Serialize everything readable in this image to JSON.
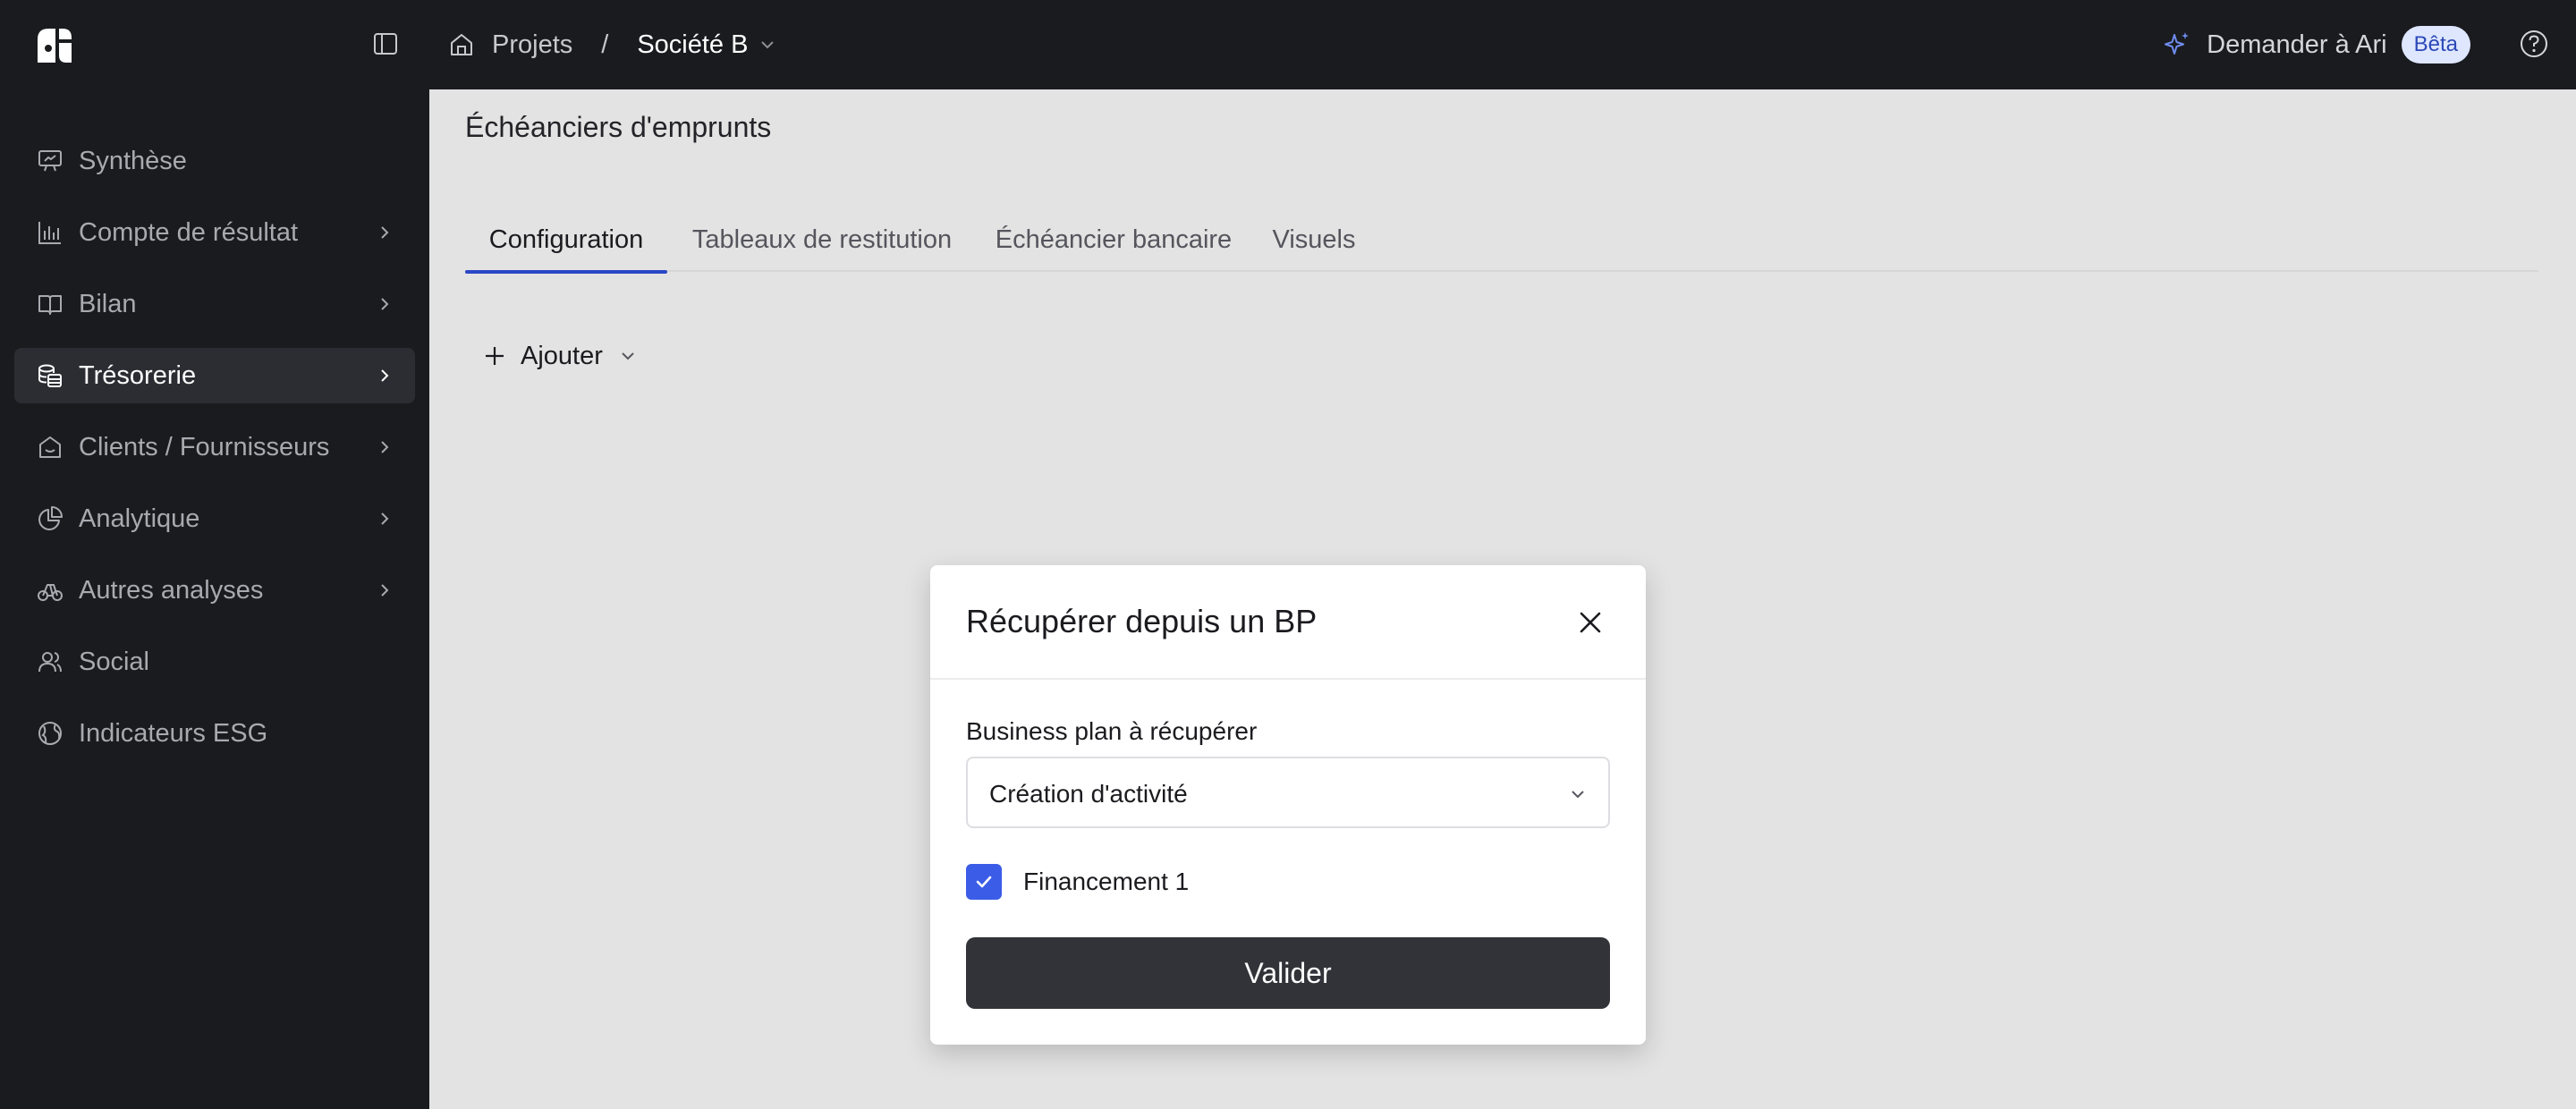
{
  "topbar": {
    "breadcrumb": {
      "root": "Projets",
      "separator": "/",
      "current": "Société B"
    },
    "ask": {
      "label": "Demander à Ari",
      "badge": "Bêta"
    }
  },
  "sidebar": {
    "items": [
      {
        "label": "Synthèse",
        "icon": "presentation-icon",
        "has_chevron": false,
        "active": false
      },
      {
        "label": "Compte de résultat",
        "icon": "bar-chart-icon",
        "has_chevron": true,
        "active": false
      },
      {
        "label": "Bilan",
        "icon": "book-icon",
        "has_chevron": true,
        "active": false
      },
      {
        "label": "Trésorerie",
        "icon": "coins-icon",
        "has_chevron": true,
        "active": true
      },
      {
        "label": "Clients / Fournisseurs",
        "icon": "store-icon",
        "has_chevron": true,
        "active": false
      },
      {
        "label": "Analytique",
        "icon": "pie-chart-icon",
        "has_chevron": true,
        "active": false
      },
      {
        "label": "Autres analyses",
        "icon": "scale-icon",
        "has_chevron": true,
        "active": false
      },
      {
        "label": "Social",
        "icon": "users-icon",
        "has_chevron": false,
        "active": false
      },
      {
        "label": "Indicateurs ESG",
        "icon": "leaf-globe-icon",
        "has_chevron": false,
        "active": false
      }
    ]
  },
  "main": {
    "title": "Échéanciers d'emprunts",
    "tabs": [
      {
        "label": "Configuration",
        "active": true
      },
      {
        "label": "Tableaux de restitution",
        "active": false
      },
      {
        "label": "Échéancier bancaire",
        "active": false
      },
      {
        "label": "Visuels",
        "active": false
      }
    ],
    "add_label": "Ajouter"
  },
  "modal": {
    "title": "Récupérer depuis un BP",
    "field_label": "Business plan à récupérer",
    "select_value": "Création d'activité",
    "checkbox_label": "Financement 1",
    "checkbox_checked": true,
    "submit_label": "Valider"
  },
  "colors": {
    "sidebar_bg": "#1a1b1f",
    "content_bg": "#e3e3e3",
    "accent": "#2a47c6",
    "checkbox": "#3b5ce6",
    "primary_button": "#323338",
    "beta_badge_bg": "#dfe7ff"
  }
}
